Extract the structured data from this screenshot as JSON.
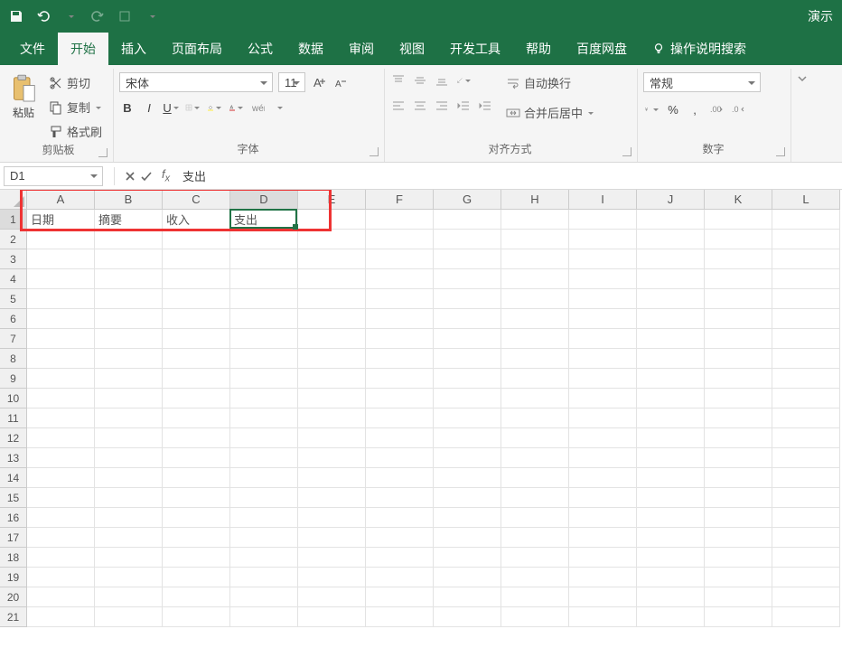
{
  "qat": {
    "presentation_label": "演示"
  },
  "tabs": {
    "file": "文件",
    "home": "开始",
    "insert": "插入",
    "layout": "页面布局",
    "formulas": "公式",
    "data": "数据",
    "review": "审阅",
    "view": "视图",
    "dev": "开发工具",
    "help": "帮助",
    "baidu": "百度网盘",
    "tellme": "操作说明搜索"
  },
  "ribbon": {
    "clipboard": {
      "paste": "粘贴",
      "cut": "剪切",
      "copy": "复制",
      "painter": "格式刷",
      "label": "剪贴板"
    },
    "font": {
      "name": "宋体",
      "size": "11",
      "label": "字体"
    },
    "align": {
      "wrap": "自动换行",
      "merge": "合并后居中",
      "label": "对齐方式"
    },
    "number": {
      "format": "常规",
      "label": "数字"
    }
  },
  "formula_bar": {
    "namebox": "D1",
    "value": "支出"
  },
  "grid": {
    "columns": [
      "A",
      "B",
      "C",
      "D",
      "E",
      "F",
      "G",
      "H",
      "I",
      "J",
      "K",
      "L"
    ],
    "row_count": 21,
    "selected_col_index": 3,
    "selected_row_index": 0,
    "cells": {
      "A1": "日期",
      "B1": "摘要",
      "C1": "收入",
      "D1": "支出"
    },
    "annotation_box": {
      "left_col": 0,
      "right_col": 4,
      "top_row": -1,
      "bottom_row": 0
    }
  }
}
